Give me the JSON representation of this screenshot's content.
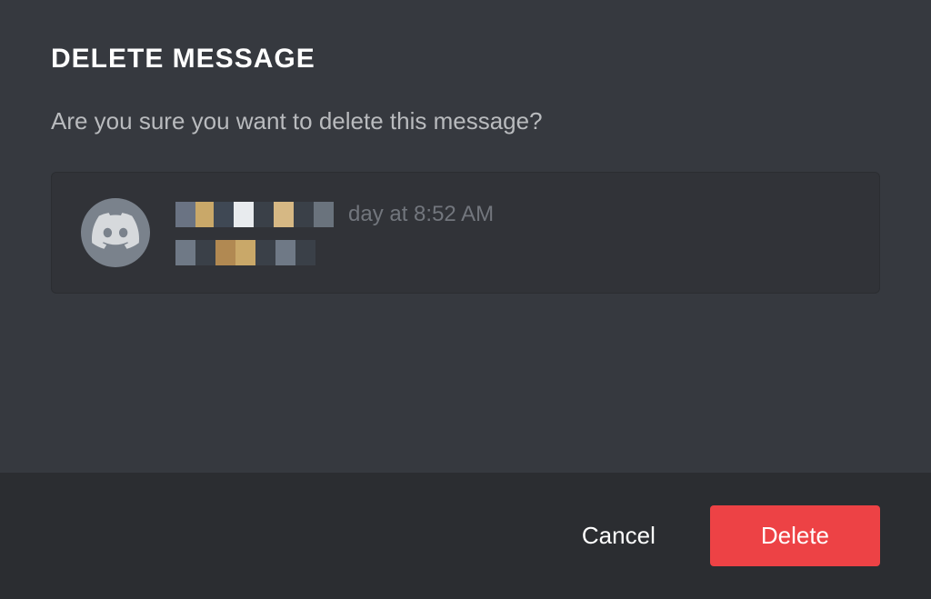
{
  "modal": {
    "title": "DELETE MESSAGE",
    "confirm_text": "Are you sure you want to delete this message?",
    "message": {
      "timestamp_visible_part": "day at 8:52 AM"
    },
    "footer": {
      "cancel_label": "Cancel",
      "delete_label": "Delete"
    }
  },
  "colors": {
    "background": "#36393f",
    "footer_bg": "#2b2d31",
    "danger": "#ed4245",
    "text_muted": "#b9bbbe",
    "text_secondary": "#72767d"
  }
}
